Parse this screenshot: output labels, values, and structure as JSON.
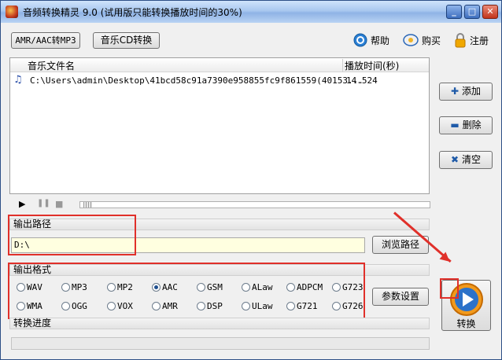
{
  "window": {
    "title": "音频转换精灵 9.0 (试用版只能转换播放时间的30%)",
    "min": "_",
    "max": "□",
    "close": "✕"
  },
  "toolbar": {
    "amr_button": "AMR/AAC转MP3",
    "cd_button": "音乐CD转换",
    "help": "帮助",
    "buy": "购买",
    "register": "注册"
  },
  "file_list": {
    "columns": [
      "音乐文件名",
      "播放时间(秒)"
    ],
    "rows": [
      {
        "name": "C:\\Users\\admin\\Desktop\\41bcd58c91a7390e958855fc9f861559(40153...",
        "duration": "14.524"
      }
    ]
  },
  "side_buttons": {
    "add": "添加",
    "delete": "删除",
    "clear": "清空"
  },
  "output_path": {
    "label": "输出路径",
    "value": "D:\\",
    "browse": "浏览路径"
  },
  "output_format": {
    "label": "输出格式",
    "selected": "AAC",
    "row1": [
      "WAV",
      "MP3",
      "MP2",
      "AAC",
      "GSM",
      "ALaw",
      "ADPCM",
      "G723"
    ],
    "row2": [
      "WMA",
      "OGG",
      "VOX",
      "AMR",
      "DSP",
      "ULaw",
      "G721",
      "G726"
    ],
    "settings": "参数设置"
  },
  "progress": {
    "label": "转换进度",
    "value": 0
  },
  "convert": {
    "label": "转换"
  },
  "colors": {
    "highlight": "#e0302a",
    "path_bg": "#ffffe0",
    "titlebar": "#a9c8ef"
  }
}
